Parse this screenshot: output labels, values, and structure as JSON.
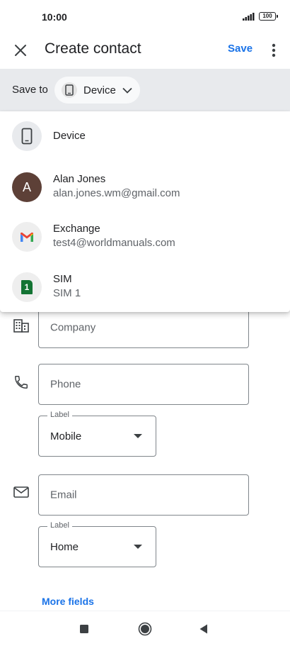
{
  "status_bar": {
    "time": "10:00",
    "battery": "100"
  },
  "app_bar": {
    "title": "Create contact",
    "save_label": "Save"
  },
  "save_to": {
    "label": "Save to",
    "selected": "Device"
  },
  "accounts": [
    {
      "title": "Device",
      "subtitle": "",
      "avatar": "phone-icon"
    },
    {
      "title": "Alan Jones",
      "subtitle": "alan.jones.wm@gmail.com",
      "avatar_letter": "A"
    },
    {
      "title": "Exchange",
      "subtitle": "test4@worldmanuals.com",
      "avatar": "gmail-logo"
    },
    {
      "title": "SIM",
      "subtitle": "SIM 1",
      "avatar_badge": "1"
    }
  ],
  "form": {
    "company_placeholder": "Company",
    "phone_placeholder": "Phone",
    "phone_label_legend": "Label",
    "phone_label_value": "Mobile",
    "email_placeholder": "Email",
    "email_label_legend": "Label",
    "email_label_value": "Home",
    "more_fields": "More fields"
  },
  "colors": {
    "accent": "#1a73e8",
    "save_to_bar": "#e8eaed",
    "alan_avatar": "#5d4037",
    "sim_badge": "#137333"
  }
}
